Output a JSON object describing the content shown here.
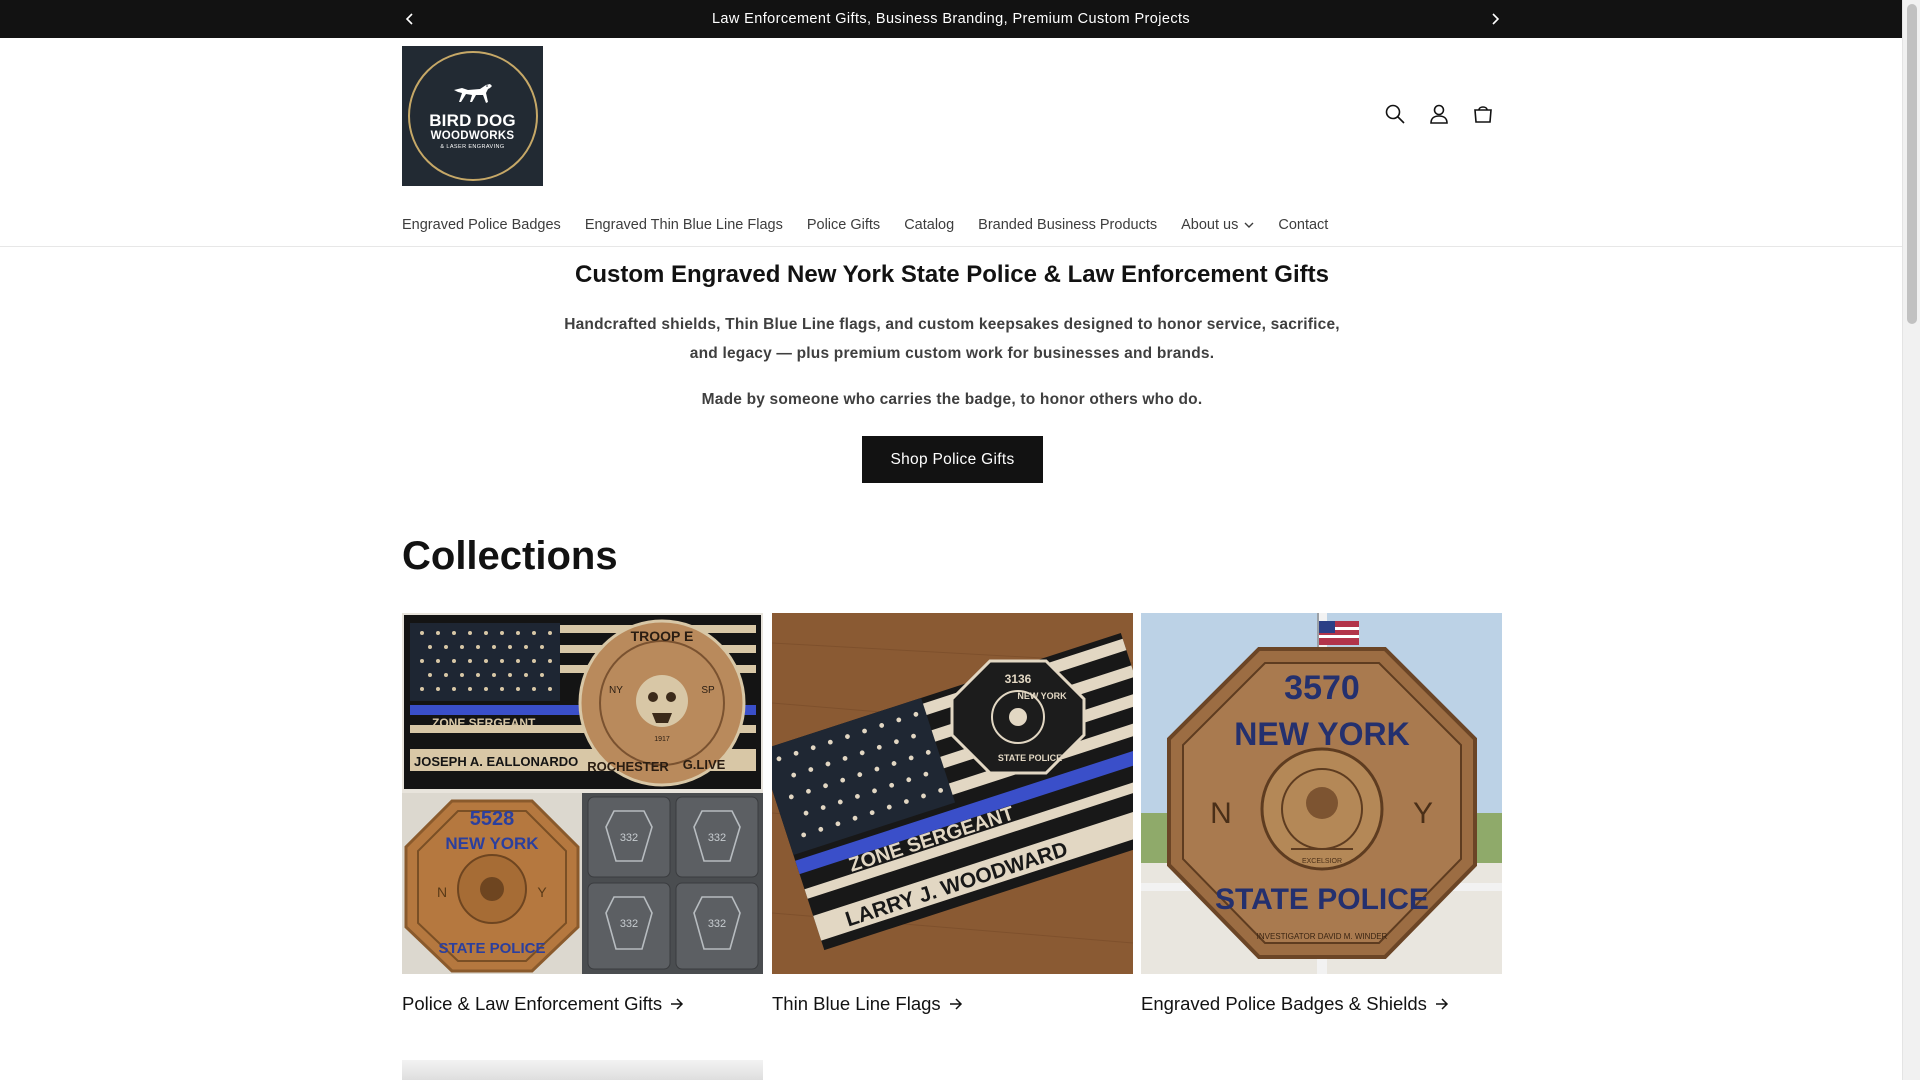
{
  "announcement": {
    "text": "Law Enforcement Gifts, Business Branding, Premium Custom Projects",
    "prev_icon": "chevron-left-icon",
    "next_icon": "chevron-right-icon"
  },
  "header": {
    "logo": {
      "line1": "BIRD DOG",
      "line2": "WOODWORKS",
      "line3": "& LASER ENGRAVING",
      "background": "#222a33",
      "ring_color": "#c6a867"
    },
    "icons": [
      "search-icon",
      "account-icon",
      "cart-icon"
    ]
  },
  "nav": {
    "items": [
      {
        "label": "Engraved Police Badges"
      },
      {
        "label": "Engraved Thin Blue Line Flags"
      },
      {
        "label": "Police Gifts"
      },
      {
        "label": "Catalog"
      },
      {
        "label": "Branded Business Products"
      },
      {
        "label": "About us",
        "has_dropdown": true
      },
      {
        "label": "Contact"
      }
    ]
  },
  "hero": {
    "title": "Custom Engraved New York State Police & Law Enforcement Gifts",
    "subtitle": "Handcrafted shields, Thin Blue Line flags, and custom keepsakes designed to honor service, sacrifice, and legacy — plus premium custom work for businesses and brands.",
    "tagline": "Made by someone who carries the badge, to honor others who do.",
    "button": "Shop Police Gifts"
  },
  "collections": {
    "title": "Collections",
    "items": [
      {
        "label": "Police & Law Enforcement Gifts",
        "image_text": {
          "flag_line1": "ZONE SERGEANT",
          "flag_line2": "JOSEPH A. EALLONARDO",
          "emblem_top": "TROOP E",
          "emblem_left": "NY",
          "emblem_right": "SP",
          "emblem_bottom_left": "ROCHESTER",
          "emblem_bottom_right": "G.LIVE",
          "emblem_year": "1917",
          "shield_number": "5528",
          "shield_arc_top": "NEW YORK",
          "shield_arc_bottom": "STATE POLICE",
          "shield_left": "N",
          "shield_right": "Y",
          "coaster_number": "332"
        }
      },
      {
        "label": "Thin Blue Line Flags",
        "image_text": {
          "line1": "ZONE SERGEANT",
          "line2": "LARRY J. WOODWARD",
          "badge_number": "3136",
          "badge_top": "NEW YORK",
          "badge_bottom": "STATE POLICE"
        }
      },
      {
        "label": "Engraved Police Badges & Shields",
        "image_text": {
          "number": "3570",
          "arc_top": "NEW YORK",
          "arc_bottom": "STATE POLICE",
          "left": "N",
          "right": "Y",
          "motto": "EXCELSIOR",
          "bottom": "INVESTIGATOR DAVID M. WINDER"
        }
      }
    ]
  },
  "colors": {
    "text": "#121212",
    "announcement_bg": "#121212",
    "button_bg": "#121212",
    "thin_blue_line": "#3a4fc9",
    "wood": "#b98a5c",
    "wood_dark": "#7a5230"
  }
}
